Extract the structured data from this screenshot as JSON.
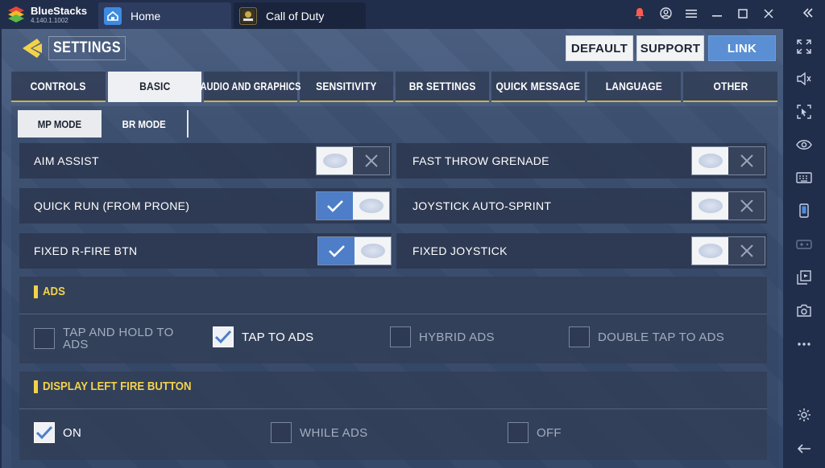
{
  "app": {
    "name": "BlueStacks",
    "version": "4.140.1.1002"
  },
  "tabs": [
    {
      "label": "Home",
      "icon": "home-icon"
    },
    {
      "label": "Call of Duty",
      "icon": "call-of-duty-icon"
    }
  ],
  "window_controls": [
    "bell-icon",
    "account-icon",
    "menu-icon",
    "minimize-icon",
    "maximize-icon",
    "close-icon"
  ],
  "sidebar_icons": [
    "fullscreen-icon",
    "volume-icon",
    "pointer-lock-icon",
    "eye-icon",
    "keyboard-icon",
    "phone-rotate-icon",
    "gamepad-icon",
    "multi-instance-icon",
    "camera-icon",
    "more-icon",
    "gear-icon",
    "back-arrow-icon"
  ],
  "colors": {
    "accent": "#f3d24a",
    "link": "#5b8fd4",
    "titlebar": "#212e4b"
  },
  "settings": {
    "title": "SETTINGS",
    "buttons": {
      "default": "DEFAULT",
      "support": "SUPPORT",
      "link": "LINK"
    },
    "main_tabs": [
      "CONTROLS",
      "BASIC",
      "AUDIO AND GRAPHICS",
      "SENSITIVITY",
      "BR SETTINGS",
      "QUICK MESSAGE",
      "LANGUAGE",
      "OTHER"
    ],
    "active_main_tab": "BASIC",
    "mode_tabs": [
      "MP MODE",
      "BR MODE"
    ],
    "active_mode_tab": "MP MODE",
    "toggles": [
      {
        "label": "AIM ASSIST",
        "state": "off"
      },
      {
        "label": "FAST THROW GRENADE",
        "state": "off"
      },
      {
        "label": "QUICK RUN (FROM PRONE)",
        "state": "on"
      },
      {
        "label": "JOYSTICK AUTO-SPRINT",
        "state": "off"
      },
      {
        "label": "FIXED R-FIRE BTN",
        "state": "on"
      },
      {
        "label": "FIXED JOYSTICK",
        "state": "off"
      }
    ],
    "ads": {
      "title": "ADS",
      "options": [
        {
          "label": "TAP AND HOLD TO ADS",
          "checked": false
        },
        {
          "label": "TAP TO ADS",
          "checked": true
        },
        {
          "label": "HYBRID ADS",
          "checked": false
        },
        {
          "label": "DOUBLE TAP TO ADS",
          "checked": false
        }
      ]
    },
    "fire_button": {
      "title": "DISPLAY LEFT FIRE BUTTON",
      "options": [
        {
          "label": "ON",
          "checked": true
        },
        {
          "label": "WHILE ADS",
          "checked": false
        },
        {
          "label": "OFF",
          "checked": false
        }
      ]
    }
  }
}
